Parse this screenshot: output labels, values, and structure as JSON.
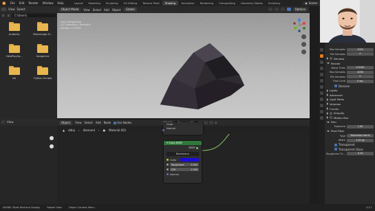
{
  "topbar": {
    "menus": [
      "File",
      "Edit",
      "Render",
      "Window",
      "Help"
    ],
    "workspaces": [
      "Layout",
      "Modeling",
      "Sculpting",
      "UV Editing",
      "Texture Paint",
      "Shading",
      "Animation",
      "Rendering",
      "Compositing",
      "Geometry Nodes",
      "Scripting"
    ],
    "active_workspace": "Shading",
    "scene": "Scene"
  },
  "file_browser": {
    "header": [
      "View",
      "Select"
    ],
    "path": "C:\\Users\\",
    "files": [
      {
        "name": "Audacity"
      },
      {
        "name": "Blackmagic D..."
      },
      {
        "name": "HeloPlaySa..."
      },
      {
        "name": "ImageLine"
      },
      {
        "name": "KA"
      },
      {
        "name": "Python Scripts"
      }
    ]
  },
  "viewport": {
    "mode": "Object Mode",
    "menus": [
      "View",
      "Select",
      "Add",
      "Object"
    ],
    "shading": "Global",
    "options": "Options",
    "info": [
      "User Perspective",
      "(1) Collection | Diamond",
      "Sample 17/1024"
    ]
  },
  "timeline": {
    "view": "View"
  },
  "node_editor": {
    "header": {
      "object": "Object",
      "menus": [
        "View",
        "Select",
        "Add",
        "Node"
      ],
      "use_nodes": "Use Nodes",
      "slot": "Slot 1",
      "material": "Material.001"
    },
    "breadcrumb": [
      "ddiaj",
      "diamond",
      "Material.001"
    ],
    "top_node_rows": [
      "Color",
      "Normal"
    ],
    "bsdf": {
      "title": "Glass BSDF",
      "output": "BSDF",
      "distribution": "Beckmann",
      "rows": [
        {
          "label": "Color",
          "value": ""
        },
        {
          "label": "Roughness",
          "value": "0.000"
        },
        {
          "label": "IOR",
          "value": "1.930"
        },
        {
          "label": "Normal",
          "value": ""
        }
      ]
    }
  },
  "properties": {
    "rows": [
      {
        "type": "value",
        "label": "Max Samples",
        "value": "1024"
      },
      {
        "type": "value",
        "label": "Min Samples",
        "value": "0"
      },
      {
        "type": "section",
        "label": "Denoise",
        "check": "off"
      },
      {
        "type": "section",
        "label": "Render",
        "open": true
      },
      {
        "type": "value",
        "label": "Noise Thres",
        "value": "0.0100"
      },
      {
        "type": "value",
        "label": "Max Samples",
        "value": "4096"
      },
      {
        "type": "value",
        "label": "Min Samples",
        "value": "0"
      },
      {
        "type": "value",
        "label": "Time Limit",
        "value": "0 sec"
      },
      {
        "type": "check",
        "label": "Denoise"
      },
      {
        "type": "section",
        "label": "Lights",
        "open": false
      },
      {
        "type": "section",
        "label": "Advanced",
        "open": false
      },
      {
        "type": "section",
        "label": "Light Paths",
        "open": false
      },
      {
        "type": "section",
        "label": "Volumes",
        "open": false
      },
      {
        "type": "section",
        "label": "Curves",
        "open": false
      },
      {
        "type": "section",
        "label": "Simplify",
        "check": "off"
      },
      {
        "type": "section",
        "label": "Motion Blur",
        "check": "off"
      },
      {
        "type": "section",
        "label": "Film",
        "open": true
      },
      {
        "type": "value",
        "label": "Exposure",
        "value": "1.00"
      },
      {
        "type": "section",
        "label": "Pixel Filter",
        "open": true
      },
      {
        "type": "value",
        "label": "Type",
        "value": "Blackman-Harris"
      },
      {
        "type": "value",
        "label": "Width",
        "value": "1.50 px"
      },
      {
        "type": "check",
        "label": "Transparent"
      },
      {
        "type": "check",
        "label": "Transparent Glass"
      },
      {
        "type": "value",
        "label": "Roughness Th...",
        "value": "0.10"
      }
    ]
  },
  "status": {
    "items": [
      "NURBS: Blast Retrieve Display",
      "Rotate View",
      "Object Context Menu"
    ],
    "version": "3.3.1"
  },
  "colors": {
    "accent": "#e07b1a",
    "bsdf_header": "#2f7a3a",
    "glass_color": "#1c0bd9",
    "folder": "#e8b64e"
  }
}
